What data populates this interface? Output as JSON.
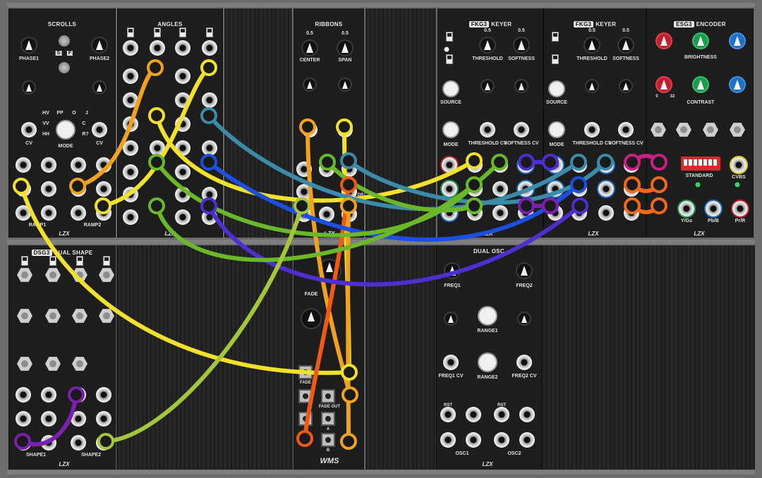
{
  "modules": {
    "scrolls": {
      "title": "SCROLLS",
      "phase1": "PHASE1",
      "phase2": "PHASE2",
      "cv_left": "CV",
      "cv_right": "CV",
      "mode": "MODE",
      "ramp1": "RAMP1",
      "ramp2": "RAMP2",
      "s_label": "S",
      "f_label": "F",
      "mode_letters": [
        "HV",
        "PP",
        "O",
        "J",
        "VV",
        "C",
        "HH",
        "R?"
      ],
      "jack_labels": [
        "A",
        "B",
        "L",
        "IL",
        "A",
        "B",
        "L",
        "IL"
      ]
    },
    "angles": {
      "title": "ANGLES"
    },
    "ribbons": {
      "title": "RIBBONS",
      "center": "CENTER",
      "span": "SPAN",
      "val_left": "0.5",
      "val_right": "0.5",
      "jack_label": "DR"
    },
    "fkg3_left": {
      "tag": "FKG3",
      "title": "KEYER",
      "threshold": "THRESHOLD",
      "softness": "SOFTNESS",
      "source": "SOURCE",
      "mode": "MODE",
      "threshold_cv": "THRESHOLD CV",
      "softness_cv": "SOFTNESS CV",
      "val": "0.5"
    },
    "fkg3_right": {
      "tag": "FKG3",
      "title": "KEYER",
      "threshold": "THRESHOLD",
      "softness": "SOFTNESS",
      "source": "SOURCE",
      "mode": "MODE",
      "threshold_cv": "THRESHOLD CV",
      "softness_cv": "SOFTNESS CV",
      "val": "0.5"
    },
    "esg3": {
      "tag": "ESG3",
      "title": "ENCODER",
      "brightness": "BRIGHTNESS",
      "contrast": "CONTRAST",
      "standard": "STANDARD",
      "cvbs": "CVBS",
      "y_g": "Y/Gs",
      "pb_b": "Pb/B",
      "pr_r": "Pr/R",
      "scale_low": "0",
      "scale_high": "32"
    },
    "dsg3": {
      "tag": "DSG3",
      "title": "DUAL SHAPE",
      "shape1": "SHAPE1",
      "shape2": "SHAPE2"
    },
    "fade": {
      "title": "FADE",
      "fade_label": "FADE",
      "fade_out": "FADE OUT",
      "fade_cv": "FADE",
      "a": "A",
      "b": "B",
      "logo": "WMS"
    },
    "dual_osc": {
      "title": "DUAL OSC",
      "freq1": "FREQ1",
      "freq2": "FREQ2",
      "range1": "RANGE1",
      "range2": "RANGE2",
      "freq1_cv": "FREQ1 CV",
      "freq2_cv": "FREQ2 CV",
      "osc1": "OSC1",
      "osc2": "OSC2",
      "rst": "RST"
    }
  },
  "brand_badge": "LZX",
  "cable_colors": {
    "yellow": "#f2e12a",
    "orange": "#f0a21c",
    "red_orange": "#ee5a16",
    "teal": "#3b8aa8",
    "blue": "#1c4fe0",
    "indigo": "#4d2fd0",
    "green": "#6ab82a",
    "lime": "#a4c63a",
    "purple": "#7a1fb0",
    "magenta": "#c81f86",
    "orange2": "#f06818"
  }
}
